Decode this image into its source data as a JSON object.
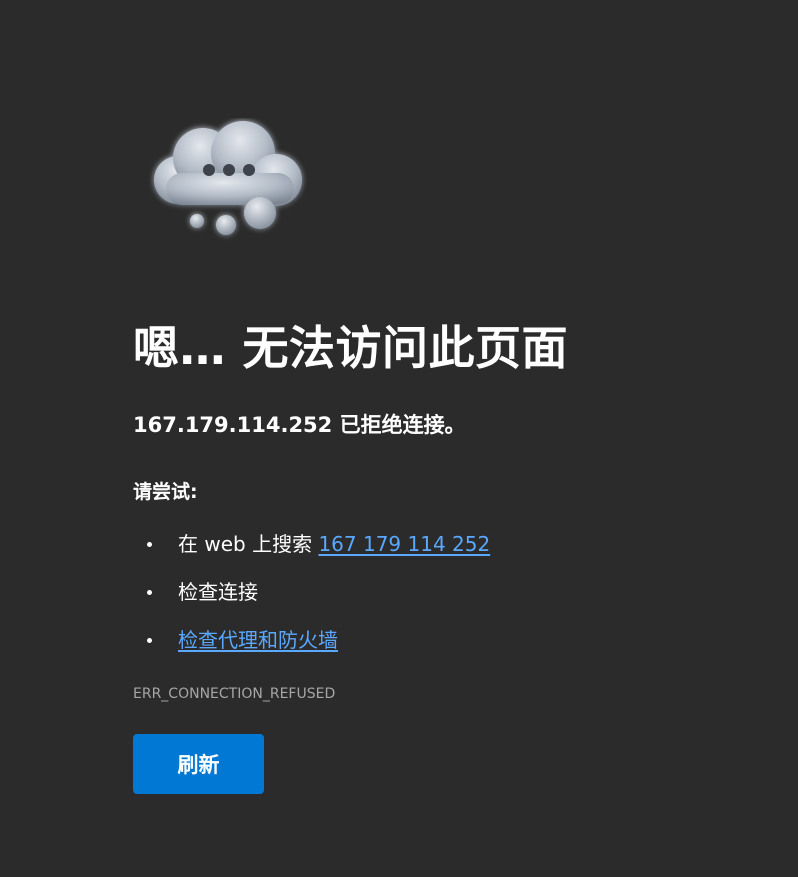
{
  "error": {
    "icon": "cloud-dots-icon",
    "title": "嗯… 无法访问此页面",
    "message": "167.179.114.252 已拒绝连接。",
    "try_heading": "请尝试:",
    "suggestions": [
      {
        "prefix": "在 web 上搜索 ",
        "link": "167 179 114 252"
      },
      {
        "text": "检查连接"
      },
      {
        "link": "检查代理和防火墙"
      }
    ],
    "code": "ERR_CONNECTION_REFUSED",
    "refresh_label": "刷新"
  },
  "colors": {
    "background": "#2b2b2b",
    "text": "#ffffff",
    "link": "#5aa8ff",
    "muted": "#a6a6a6",
    "button": "#0078d4"
  }
}
